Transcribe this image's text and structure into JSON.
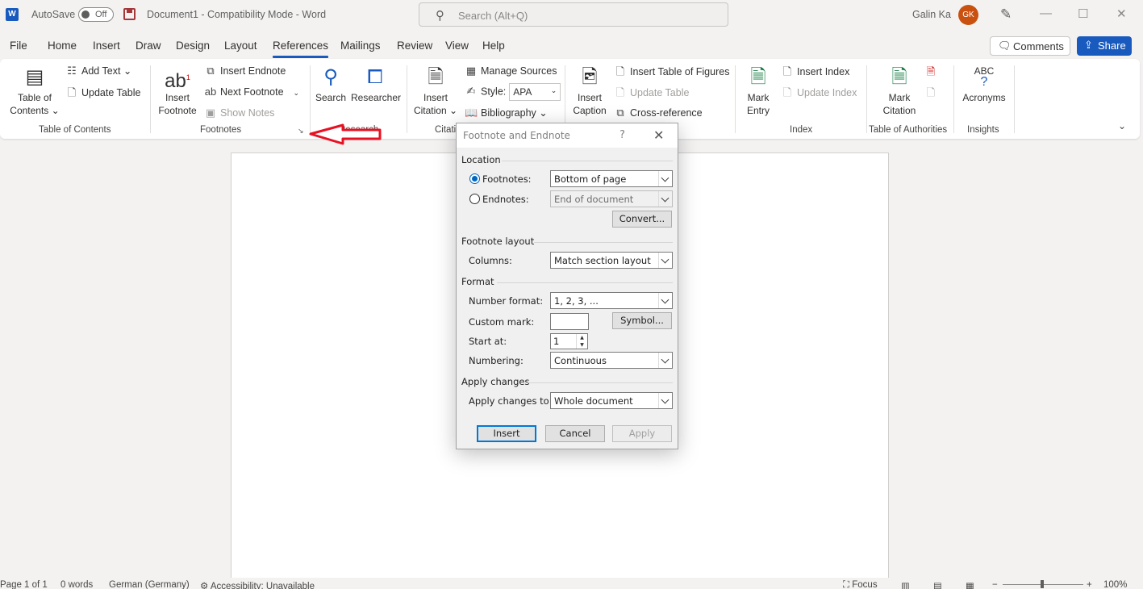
{
  "titlebar": {
    "app_logo": "W",
    "autosave_label": "AutoSave",
    "autosave_state": "Off",
    "doc_title": "Document1  -  Compatibility Mode  -  Word",
    "search_placeholder": "Search (Alt+Q)",
    "user_name": "Galin  Ka",
    "user_initials": "GK",
    "minimize": "—",
    "maximize": "☐",
    "close": "✕"
  },
  "menu": {
    "tabs": [
      "File",
      "Home",
      "Insert",
      "Draw",
      "Design",
      "Layout",
      "References",
      "Mailings",
      "Review",
      "View",
      "Help"
    ],
    "active_tab": "References",
    "comments_label": "Comments",
    "share_label": "Share"
  },
  "ribbon": {
    "toc": {
      "big_label_1": "Table of",
      "big_label_2": "Contents ⌄",
      "add_text": "Add Text ⌄",
      "update_table": "Update Table",
      "group": "Table of Contents"
    },
    "footnotes": {
      "insert_footnote_1": "Insert",
      "insert_footnote_2": "Footnote",
      "insert_endnote": "Insert Endnote",
      "next_footnote": "Next Footnote",
      "show_notes": "Show Notes",
      "group": "Footnotes"
    },
    "research": {
      "search": "Search",
      "researcher": "Researcher",
      "group": "Research"
    },
    "citations": {
      "insert_citation_1": "Insert",
      "insert_citation_2": "Citation ⌄",
      "manage_sources": "Manage Sources",
      "style_label": "Style:",
      "style_value": "APA",
      "bibliography": "Bibliography ⌄",
      "group": "Citati"
    },
    "captions": {
      "insert_caption_1": "Insert",
      "insert_caption_2": "Caption",
      "insert_table_of_figures": "Insert Table of Figures",
      "update_table": "Update Table",
      "cross_reference": "Cross-reference"
    },
    "index": {
      "mark_entry_1": "Mark",
      "mark_entry_2": "Entry",
      "insert_index": "Insert Index",
      "update_index": "Update Index",
      "group": "Index"
    },
    "authorities": {
      "mark_citation_1": "Mark",
      "mark_citation_2": "Citation",
      "group": "Table of Authorities"
    },
    "insights": {
      "acronyms_icon": "ABC",
      "acronyms": "Acronyms",
      "group": "Insights"
    }
  },
  "dialog": {
    "title": "Footnote and Endnote",
    "help": "?",
    "close": "✕",
    "location_section": "Location",
    "footnotes_label": "Footnotes:",
    "footnotes_value": "Bottom of page",
    "endnotes_label": "Endnotes:",
    "endnotes_value": "End of document",
    "convert_button": "Convert...",
    "layout_section": "Footnote layout",
    "columns_label": "Columns:",
    "columns_value": "Match section layout",
    "format_section": "Format",
    "number_format_label": "Number format:",
    "number_format_value": "1, 2, 3, ...",
    "custom_mark_label": "Custom mark:",
    "custom_mark_value": "",
    "symbol_button": "Symbol...",
    "start_at_label": "Start at:",
    "start_at_value": "1",
    "numbering_label": "Numbering:",
    "numbering_value": "Continuous",
    "apply_section": "Apply changes",
    "apply_to_label": "Apply changes to:",
    "apply_to_value": "Whole document",
    "insert_button": "Insert",
    "cancel_button": "Cancel",
    "apply_button": "Apply"
  },
  "statusbar": {
    "page": "Page 1 of 1",
    "words": "0 words",
    "language": "German (Germany)",
    "accessibility": "Accessibility: Unavailable",
    "focus": "Focus",
    "zoom": "100%"
  },
  "colors": {
    "accent": "#185abd",
    "annotation_arrow": "#e81123"
  }
}
